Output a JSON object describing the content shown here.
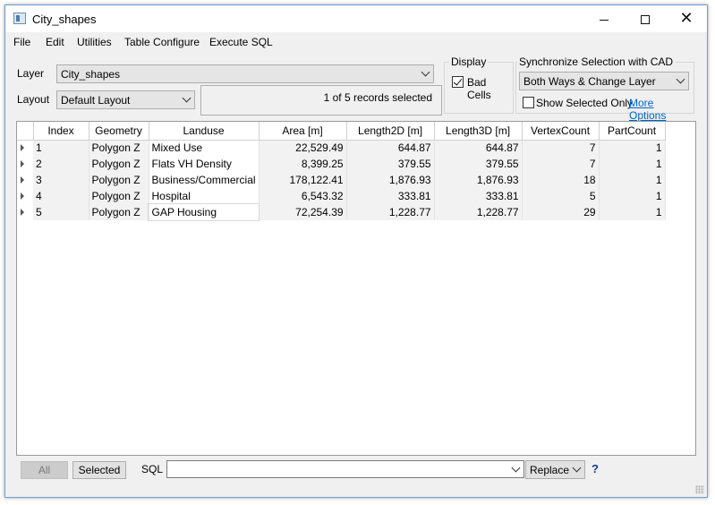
{
  "window": {
    "title": "City_shapes",
    "minimize": "—",
    "maximize": "□",
    "close": "✕"
  },
  "menu": [
    "File",
    "Edit",
    "Utilities",
    "Table Configure",
    "Execute SQL"
  ],
  "layer": {
    "label": "Layer",
    "value": "City_shapes"
  },
  "layout": {
    "label": "Layout",
    "value": "Default Layout"
  },
  "status": "1 of 5 records selected",
  "display": {
    "title": "Display",
    "bad_cells_label": "Bad Cells",
    "bad_cells_checked": true
  },
  "sync": {
    "title": "Synchronize Selection with CAD",
    "value": "Both Ways & Change Layer",
    "show_selected_label": "Show Selected Only",
    "show_selected_checked": false,
    "more_options": "More Options"
  },
  "table": {
    "columns": [
      "Index",
      "Geometry",
      "Landuse",
      "Area [m]",
      "Length2D [m]",
      "Length3D [m]",
      "VertexCount",
      "PartCount"
    ],
    "rows": [
      [
        "1",
        "Polygon Z",
        "Mixed Use",
        "22,529.49",
        "644.87",
        "644.87",
        "7",
        "1"
      ],
      [
        "2",
        "Polygon Z",
        "Flats VH Density",
        "8,399.25",
        "379.55",
        "379.55",
        "7",
        "1"
      ],
      [
        "3",
        "Polygon Z",
        "Business/Commercial",
        "178,122.41",
        "1,876.93",
        "1,876.93",
        "18",
        "1"
      ],
      [
        "4",
        "Polygon Z",
        "Hospital",
        "6,543.32",
        "333.81",
        "333.81",
        "5",
        "1"
      ],
      [
        "5",
        "Polygon Z",
        "GAP Housing",
        "72,254.39",
        "1,228.77",
        "1,228.77",
        "29",
        "1"
      ]
    ]
  },
  "bottom": {
    "all_label": "All",
    "selected_label": "Selected",
    "sql_label": "SQL",
    "sql_value": "",
    "replace_value": "Replace",
    "help": "?"
  }
}
